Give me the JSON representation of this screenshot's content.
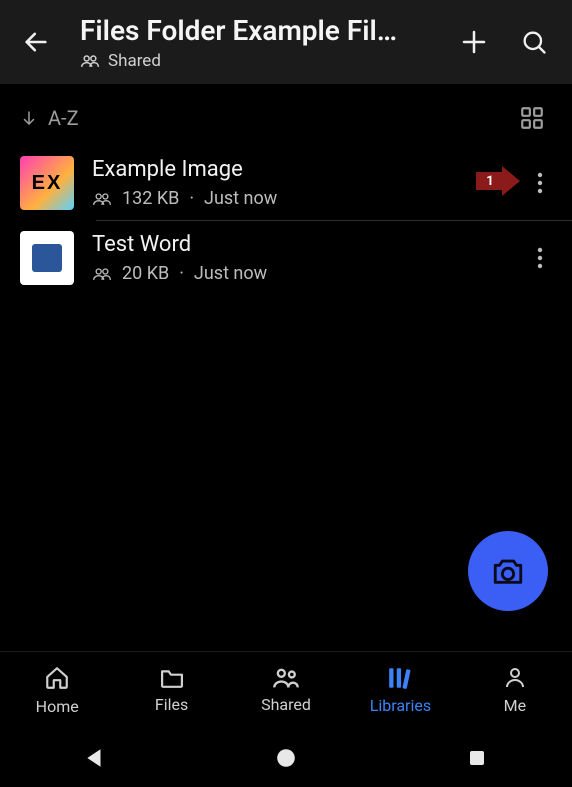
{
  "header": {
    "title": "Files Folder Example Fil…",
    "subtitle_label": "Shared"
  },
  "sort": {
    "label": "A-Z"
  },
  "files": [
    {
      "name": "Example Image",
      "size": "132 KB",
      "time": "Just now",
      "sep": "·",
      "thumb_text": "EX"
    },
    {
      "name": "Test Word",
      "size": "20 KB",
      "time": "Just now",
      "sep": "·"
    }
  ],
  "tutorial": {
    "step_number": "1"
  },
  "tabs": {
    "home": "Home",
    "files": "Files",
    "shared": "Shared",
    "libraries": "Libraries",
    "me": "Me"
  },
  "colors": {
    "accent": "#3b82f6",
    "fab": "#3b5ef5",
    "arrow": "#8b1a1a"
  }
}
